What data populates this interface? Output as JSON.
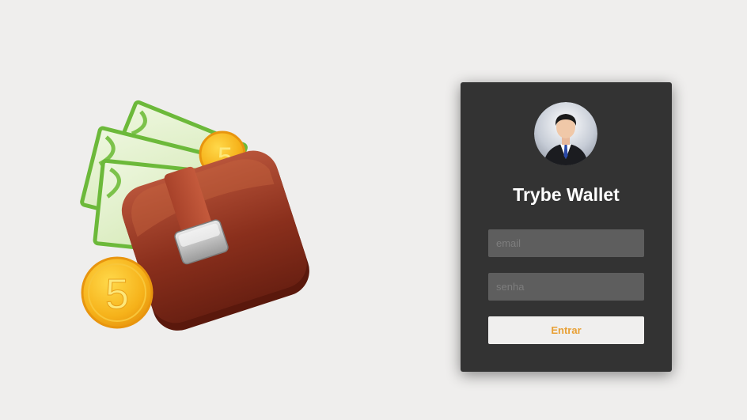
{
  "illustration": {
    "icon": "wallet-money-icon",
    "coin_label": "5"
  },
  "login": {
    "avatar_icon": "user-avatar-icon",
    "title": "Trybe Wallet",
    "email_placeholder": "email",
    "password_placeholder": "senha",
    "submit_label": "Entrar"
  },
  "colors": {
    "background": "#efeeed",
    "card": "#333333",
    "input": "#5e5e5e",
    "button": "#f0efee",
    "button_text": "#e8a035"
  }
}
